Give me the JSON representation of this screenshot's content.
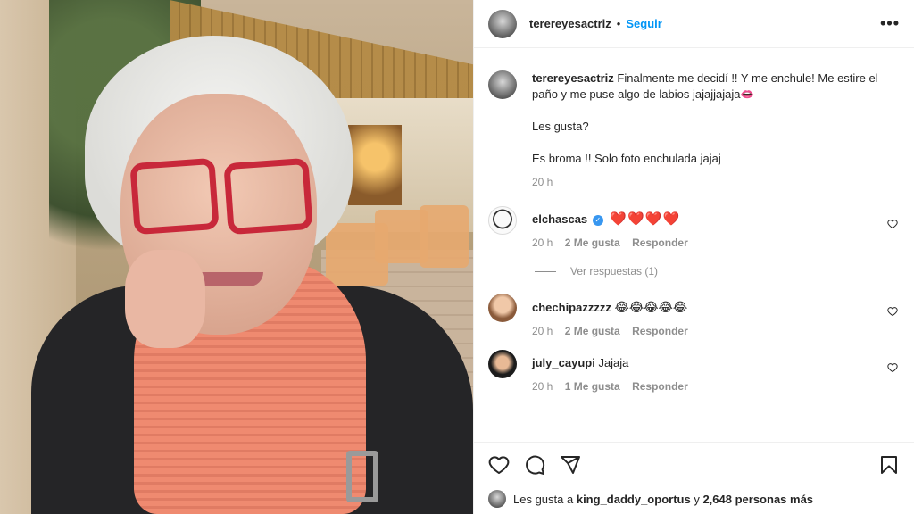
{
  "post": {
    "username": "terereyesactriz",
    "follow_label": "Seguir",
    "separator": "•",
    "more_label": "•••"
  },
  "caption": {
    "username": "terereyesactriz",
    "line1": "Finalmente me decidí !! Y me enchule! Me estire el paño y me puse algo de labios jajajjajaja👄",
    "line2": "Les gusta?",
    "line3": "Es broma !! Solo foto enchulada jajaj",
    "time": "20 h"
  },
  "comments": [
    {
      "username": "elchascas",
      "verified": true,
      "text": "❤️❤️❤️❤️",
      "time": "20 h",
      "likes": "2 Me gusta",
      "reply": "Responder",
      "view_replies": "Ver respuestas (1)"
    },
    {
      "username": "chechipazzzzz",
      "verified": false,
      "text": "😂😂😂😂😂",
      "time": "20 h",
      "likes": "2 Me gusta",
      "reply": "Responder"
    },
    {
      "username": "july_cayupi",
      "verified": false,
      "text": "Jajaja",
      "time": "20 h",
      "likes": "1 Me gusta",
      "reply": "Responder"
    }
  ],
  "likes_bar": {
    "prefix": "Les gusta a",
    "user": "king_daddy_oportus",
    "connector": "y",
    "count": "2,648 personas más"
  },
  "icons": [
    "heart-icon",
    "comment-icon",
    "share-icon",
    "bookmark-icon",
    "more-icon",
    "verified-icon"
  ],
  "colors": {
    "accent": "#0095f6",
    "verified": "#3897f0",
    "muted": "#8e8e8e"
  }
}
